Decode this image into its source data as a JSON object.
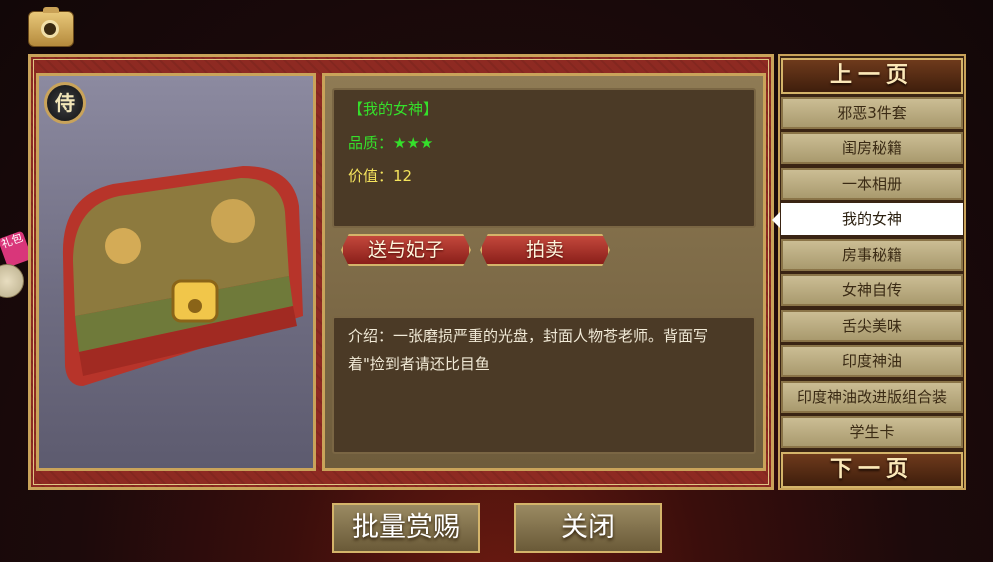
{
  "toolbar": {
    "camera_icon": "camera-icon"
  },
  "item": {
    "name": "【我的女神】",
    "quality": "品质：★★★",
    "value": "价值：12",
    "description": "介绍：一张磨损严重的光盘，封面人物苍老师。背面写着\"捡到者请还比目鱼"
  },
  "actions": {
    "gift": "送与妃子",
    "auction": "拍卖"
  },
  "badge": {
    "label": "侍"
  },
  "sidebar": {
    "prev": "上一页",
    "next": "下一页",
    "items": [
      {
        "label": "邪恶3件套"
      },
      {
        "label": "闺房秘籍"
      },
      {
        "label": "一本相册"
      },
      {
        "label": "我的女神",
        "active": true
      },
      {
        "label": "房事秘籍"
      },
      {
        "label": "女神自传"
      },
      {
        "label": "舌尖美味"
      },
      {
        "label": "印度神油"
      },
      {
        "label": "印度神油改进版组合装"
      },
      {
        "label": "学生卡"
      }
    ]
  },
  "gift_widget": {
    "label": "礼包"
  },
  "footer": {
    "batch": "批量赏赐",
    "close": "关闭"
  },
  "colors": {
    "panel_red": "#8e2a22",
    "gold_border": "#c9a35a",
    "green_text": "#35e02b",
    "yellow_text": "#f4e35c"
  }
}
